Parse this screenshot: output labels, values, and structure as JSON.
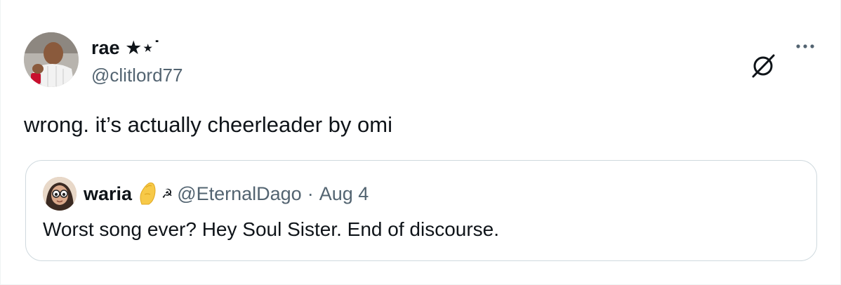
{
  "author": {
    "name": "rae",
    "name_decoration": "★⋆˙",
    "handle": "@clitlord77"
  },
  "tweet": {
    "text": "wrong. it’s actually cheerleader by omi"
  },
  "quoted": {
    "name": "waria",
    "decoration": "☭",
    "handle": "@EternalDago",
    "separator": "·",
    "date": "Aug 4",
    "text": "Worst song ever? Hey Soul Sister. End of discourse."
  },
  "icons": {
    "grok": "grok-icon",
    "more": "more-icon",
    "pinch_emoji": "pinched-fingers-emoji"
  },
  "colors": {
    "text_primary": "#0f1419",
    "text_secondary": "#536471",
    "border": "#cfd9de"
  }
}
